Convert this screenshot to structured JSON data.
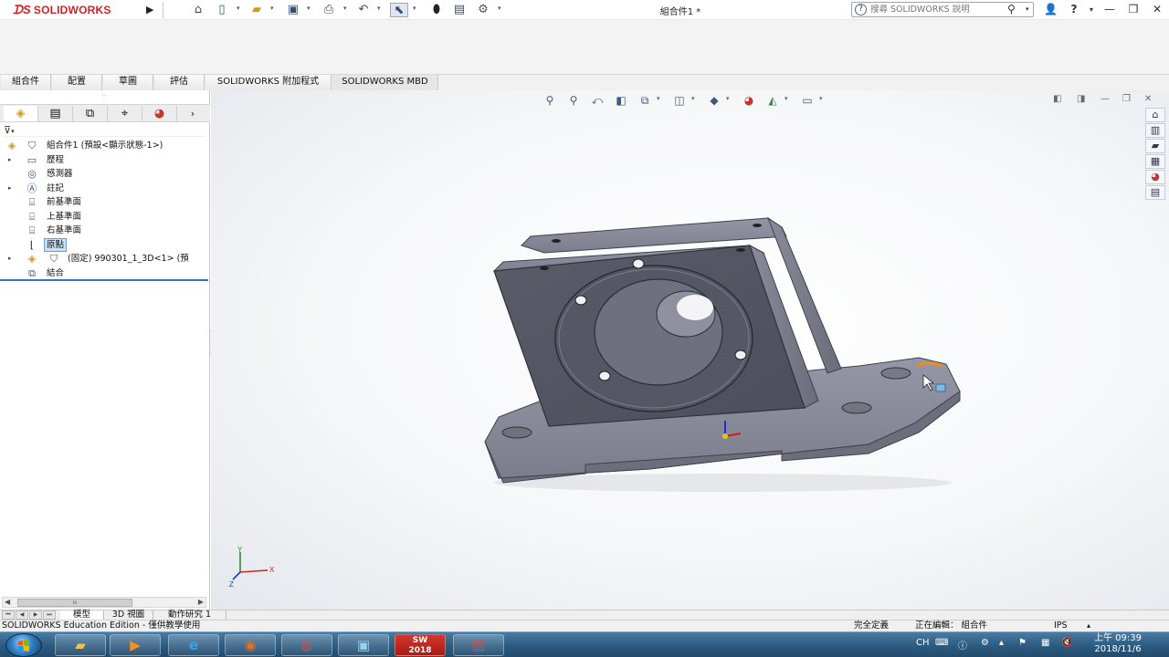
{
  "app": {
    "brand": "SOLIDWORKS",
    "document_title": "組合件1 *"
  },
  "search": {
    "placeholder": "搜尋 SOLIDWORKS 說明"
  },
  "cm_tabs": [
    {
      "label": "組合件"
    },
    {
      "label": "配置"
    },
    {
      "label": "草圖"
    },
    {
      "label": "評估"
    },
    {
      "label": "SOLIDWORKS 附加程式"
    },
    {
      "label": "SOLIDWORKS MBD"
    }
  ],
  "tree": {
    "root": "組合件1 (預設<顯示狀態-1>)",
    "items": [
      {
        "label": "歷程"
      },
      {
        "label": "感測器"
      },
      {
        "label": "註記"
      },
      {
        "label": "前基準面"
      },
      {
        "label": "上基準面"
      },
      {
        "label": "右基準面"
      },
      {
        "label": "原點"
      },
      {
        "label": "(固定) 990301_1_3D<1> (預"
      },
      {
        "label": "結合"
      }
    ]
  },
  "bottom_tabs": [
    {
      "label": "模型"
    },
    {
      "label": "3D 視圖"
    },
    {
      "label": "動作研究 1"
    }
  ],
  "status": {
    "edition": "SOLIDWORKS Education Edition - 僅供教學使用",
    "definition": "完全定義",
    "editing": "正在編輯： 組合件",
    "units": "IPS"
  },
  "taskbar": {
    "lang": "CH",
    "time": "上午 09:39",
    "date": "2018/11/6"
  },
  "triad": {
    "x": "X",
    "y": "Y",
    "z": "Z"
  },
  "colors": {
    "brand_red": "#d32027",
    "selection": "#c9e0f7",
    "taskbar": "#2c5a80",
    "model_face": "#5b5d6b"
  },
  "icons": {
    "home": "home-icon",
    "new": "new-document-icon",
    "open": "open-folder-icon",
    "save": "save-icon",
    "print": "print-icon",
    "undo": "undo-icon",
    "select": "select-pointer-icon",
    "options": "gear-icon"
  }
}
